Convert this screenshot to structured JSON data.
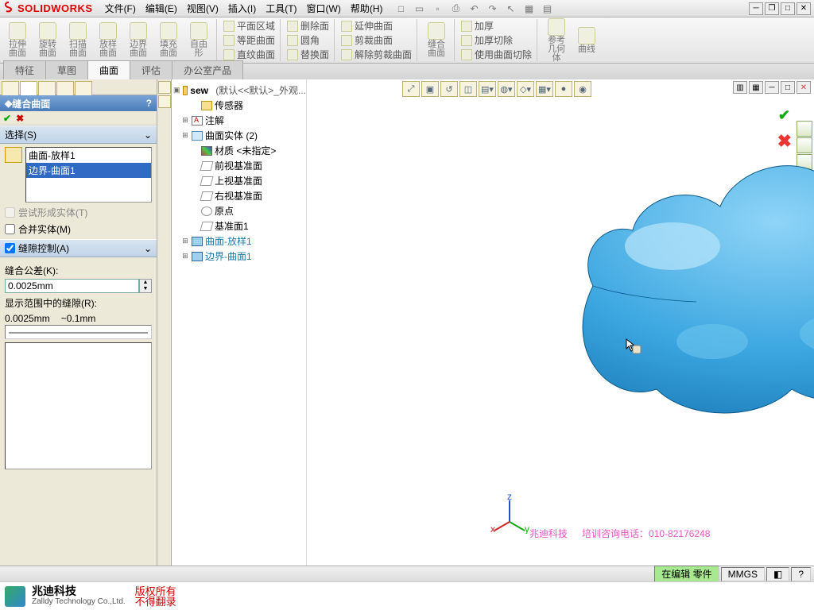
{
  "app": {
    "logo": "S",
    "name": "SOLIDWORKS"
  },
  "menu": [
    "文件(F)",
    "编辑(E)",
    "视图(V)",
    "插入(I)",
    "工具(T)",
    "窗口(W)",
    "帮助(H)"
  ],
  "ribbon_big": [
    "拉伸曲面",
    "旋转曲面",
    "扫描曲面",
    "放样曲面",
    "边界曲面",
    "填充曲面",
    "自由形"
  ],
  "ribbon_col1": [
    "平面区域",
    "等距曲面",
    "直纹曲面"
  ],
  "ribbon_col2": [
    "删除面",
    "圆角",
    "替换面"
  ],
  "ribbon_col3": [
    "延伸曲面",
    "剪裁曲面",
    "解除剪裁曲面"
  ],
  "ribbon_knit": "缝合曲面",
  "ribbon_col4": [
    "加厚",
    "加厚切除",
    "使用曲面切除"
  ],
  "ribbon_col5": [
    "参考几何体",
    "曲线"
  ],
  "tabs": [
    "特征",
    "草图",
    "曲面",
    "评估",
    "办公室产品"
  ],
  "active_tab": 2,
  "pm": {
    "title": "缝合曲面",
    "section_select": "选择(S)",
    "sel_items": [
      "曲面-放样1",
      "边界-曲面1"
    ],
    "chk_solid": "尝试形成实体(T)",
    "chk_merge": "合并实体(M)",
    "section_gap": "缝隙控制(A)",
    "tol_label": "缝合公差(K):",
    "tol_value": "0.0025mm",
    "range_label": "显示范围中的缝隙(R):",
    "range_min": "0.0025mm",
    "range_max": "~0.1mm"
  },
  "tree": {
    "root": "sew",
    "root_suffix": "(默认<<默认>_外观...",
    "items": [
      {
        "icon": "fold",
        "label": "传感器"
      },
      {
        "icon": "ann",
        "label": "注解",
        "exp": "+"
      },
      {
        "icon": "surf",
        "label": "曲面实体 (2)",
        "exp": "+"
      },
      {
        "icon": "mat",
        "label": "材质 <未指定>"
      },
      {
        "icon": "plane",
        "label": "前视基准面"
      },
      {
        "icon": "plane",
        "label": "上视基准面"
      },
      {
        "icon": "plane",
        "label": "右视基准面"
      },
      {
        "icon": "org",
        "label": "原点"
      },
      {
        "icon": "plane",
        "label": "基准面1"
      },
      {
        "icon": "feat",
        "label": "曲面-放样1",
        "hl": true,
        "exp": "+"
      },
      {
        "icon": "feat",
        "label": "边界-曲面1",
        "hl": true,
        "exp": "+"
      }
    ]
  },
  "watermark": {
    "company": "兆迪科技",
    "phone_label": "培训咨询电话：",
    "phone": "010-82176248"
  },
  "status": {
    "edit": "在编辑  零件",
    "units": "MMGS"
  },
  "footer": {
    "cn": "兆迪科技",
    "en": "Zalldy Technology Co.,Ltd.",
    "note1": "版权所有",
    "note2": "不得翻录"
  }
}
